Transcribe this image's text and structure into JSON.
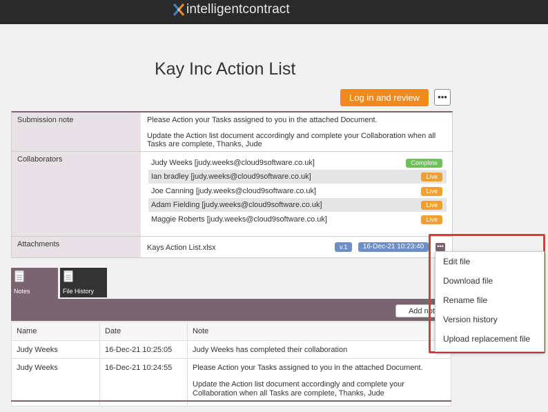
{
  "header": {
    "logo_text": "intelligentcontract",
    "brand_colors": [
      "#ee8a20",
      "#3f86c8",
      "#2a2a2a"
    ]
  },
  "page": {
    "title": "Kay Inc Action List"
  },
  "actions": {
    "login_label": "Log in and review",
    "more_label": "•••"
  },
  "submission": {
    "label": "Submission note",
    "paragraphs": [
      "Please Action your Tasks assigned to you in the attached Document.",
      "Update the Action list document accordingly and complete your Collaboration when all Tasks are complete, Thanks, Jude"
    ]
  },
  "collaborators": {
    "label": "Collaborators",
    "items": [
      {
        "name": "Judy Weeks [judy.weeks@cloud9software.co.uk]",
        "status": "Complete"
      },
      {
        "name": "Ian bradley [judy.weeks@cloud9software.co.uk]",
        "status": "Live"
      },
      {
        "name": "Joe Canning [judy.weeks@cloud9software.co.uk]",
        "status": "Live"
      },
      {
        "name": "Adam Fielding [judy.weeks@cloud9software.co.uk]",
        "status": "Live"
      },
      {
        "name": "Maggie Roberts [judy.weeks@cloud9software.co.uk]",
        "status": "Live"
      }
    ],
    "status_colors": {
      "Complete": "#6fbf5a",
      "Live": "#f0a030"
    }
  },
  "attachments": {
    "label": "Attachments",
    "file_name": "Kays Action List.xlsx",
    "version": "v.1",
    "date": "16-Dec-21 10:23:40",
    "more_label": "•••"
  },
  "tabs": [
    {
      "label": "Notes",
      "icon": "notepad-icon",
      "active": true
    },
    {
      "label": "File History",
      "icon": "notepad-icon",
      "active": false
    }
  ],
  "notes": {
    "add_label": "Add note",
    "columns": [
      "Name",
      "Date",
      "Note"
    ],
    "rows": [
      {
        "name": "Judy Weeks",
        "date": "16-Dec-21 10:25:05",
        "note": [
          "Judy Weeks has completed their collaboration"
        ]
      },
      {
        "name": "Judy Weeks",
        "date": "16-Dec-21 10:24:55",
        "note": [
          "Please Action your Tasks assigned to you in the attached Document.",
          "Update the Action list document accordingly and complete your Collaboration when all Tasks are complete, Thanks, Jude"
        ]
      }
    ]
  },
  "context_menu": {
    "items": [
      "Edit file",
      "Download file",
      "Rename file",
      "Version history",
      "Upload replacement file"
    ]
  }
}
